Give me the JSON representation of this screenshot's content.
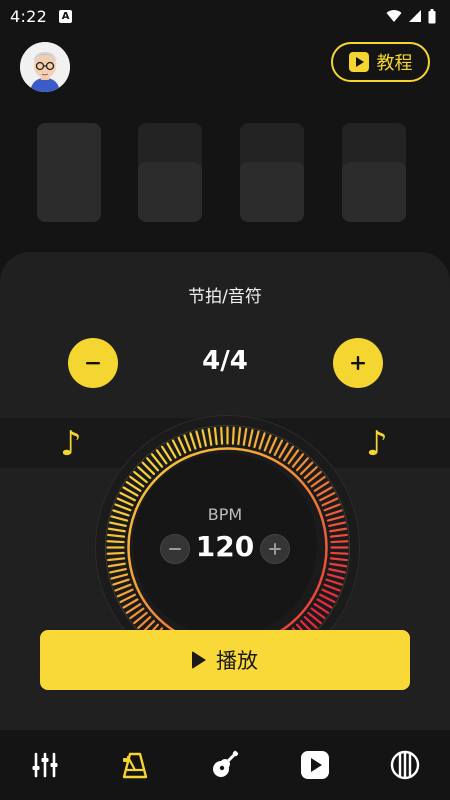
{
  "status_bar": {
    "time": "4:22",
    "badge": "A"
  },
  "header": {
    "tutorial_label": "教程"
  },
  "beats": {
    "count": 4,
    "states": [
      "full",
      "half",
      "half",
      "half"
    ]
  },
  "panel": {
    "title": "节拍/音符",
    "time_signature": "4/4",
    "minus_symbol": "−",
    "plus_symbol": "+"
  },
  "notes": {
    "left_symbol": "♪",
    "right_symbol": "♪"
  },
  "bpm": {
    "label": "BPM",
    "value": "120"
  },
  "play": {
    "label": "播放"
  },
  "nav": {
    "items": [
      {
        "icon": "mixer-icon",
        "active": false
      },
      {
        "icon": "metronome-icon",
        "active": true
      },
      {
        "icon": "guitar-icon",
        "active": false
      },
      {
        "icon": "video-play-icon",
        "active": false
      },
      {
        "icon": "drum-icon",
        "active": false
      }
    ]
  },
  "colors": {
    "accent": "#f5d631",
    "panel": "#202020",
    "background": "#141414"
  }
}
